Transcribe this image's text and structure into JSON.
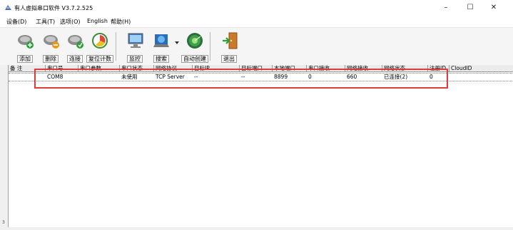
{
  "window": {
    "title": "有人虚拟串口软件 V3.7.2.525",
    "minimize": "–",
    "maximize": "☐",
    "close": "✕"
  },
  "menu": {
    "items": [
      {
        "label": "设备(D)"
      },
      {
        "label": "工具(T)"
      },
      {
        "label": "选项(O)"
      },
      {
        "label": "English"
      },
      {
        "label": "帮助(H)"
      }
    ]
  },
  "toolbar": {
    "buttons": [
      {
        "label": "添加",
        "icon": "add-device-icon"
      },
      {
        "label": "删除",
        "icon": "remove-device-icon"
      },
      {
        "label": "连接",
        "icon": "connect-icon"
      },
      {
        "label": "复位计数",
        "icon": "reset-counter-icon"
      },
      {
        "label": "监控",
        "icon": "monitor-icon"
      },
      {
        "label": "搜索",
        "icon": "search-icon"
      },
      {
        "label": "自动创建",
        "icon": "auto-create-icon"
      },
      {
        "label": "退出",
        "icon": "exit-icon"
      }
    ]
  },
  "table": {
    "columns": [
      "备 注",
      "串口号",
      "串口参数",
      "串口状态",
      "网络协议",
      "目标IP",
      "目标端口",
      "本地端口",
      "串口接收",
      "网络接收",
      "网络状态",
      "注册ID",
      "CloudID"
    ],
    "rows": [
      [
        "",
        "COM8",
        "",
        "未使用",
        "TCP Server",
        "--",
        "--",
        "8899",
        "0",
        "660",
        "已连接(2)",
        "0",
        ""
      ]
    ]
  },
  "colors": {
    "highlight": "#e03b3b",
    "toolbar_bg": "#f5f5f5",
    "header_bg": "#ebebeb"
  }
}
